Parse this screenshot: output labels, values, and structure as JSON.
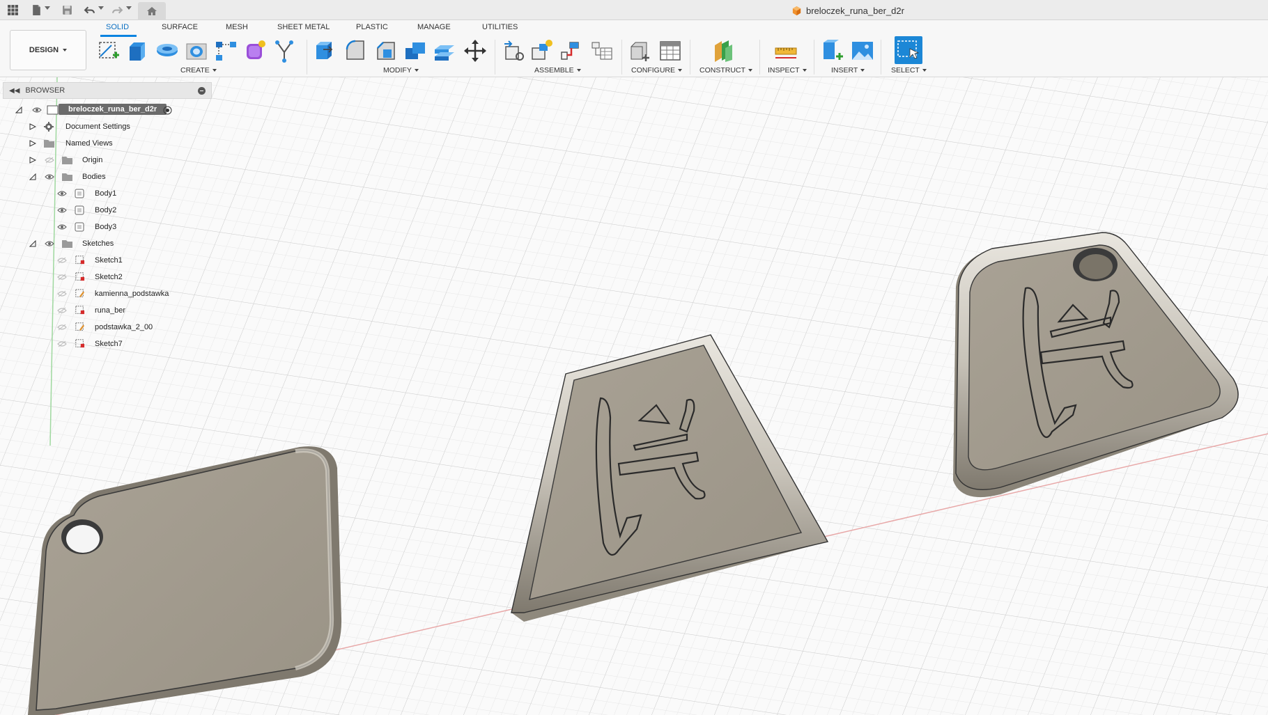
{
  "title_bar": {
    "document_title": "breloczek_runa_ber_d2r",
    "icons": [
      "grid-menu-icon",
      "file-icon",
      "save-icon",
      "undo-icon",
      "redo-icon",
      "home-icon",
      "document-cube-icon"
    ]
  },
  "toolbar": {
    "workspace_label": "DESIGN",
    "tabs": [
      {
        "label": "SOLID",
        "active": true
      },
      {
        "label": "SURFACE",
        "active": false
      },
      {
        "label": "MESH",
        "active": false
      },
      {
        "label": "SHEET METAL",
        "active": false
      },
      {
        "label": "PLASTIC",
        "active": false
      },
      {
        "label": "MANAGE",
        "active": false
      },
      {
        "label": "UTILITIES",
        "active": false
      }
    ],
    "groups": [
      {
        "label": "CREATE",
        "tools": [
          "create-sketch-icon",
          "extrude-icon",
          "revolve-icon",
          "hole-icon",
          "rectangular-pattern-icon",
          "create-form-icon",
          "derive-icon"
        ]
      },
      {
        "label": "MODIFY",
        "tools": [
          "press-pull-icon",
          "fillet-icon",
          "chamfer-icon",
          "combine-icon",
          "offset-face-icon",
          "move-icon"
        ]
      },
      {
        "label": "ASSEMBLE",
        "tools": [
          "new-component-icon",
          "joint-icon",
          "as-built-joint-icon",
          "joint-origin-icon"
        ]
      },
      {
        "label": "CONFIGURE",
        "tools": [
          "configure-icon",
          "configuration-table-icon"
        ]
      },
      {
        "label": "CONSTRUCT",
        "tools": [
          "offset-plane-icon"
        ]
      },
      {
        "label": "INSPECT",
        "tools": [
          "measure-icon"
        ]
      },
      {
        "label": "INSERT",
        "tools": [
          "insert-derive-icon",
          "insert-image-icon"
        ]
      },
      {
        "label": "SELECT",
        "tools": [
          "select-icon"
        ]
      }
    ],
    "accent_color": "#0a83e0"
  },
  "browser": {
    "title": "BROWSER",
    "root": "breloczek_runa_ber_d2r",
    "items": [
      {
        "label": "Document Settings",
        "icon": "gear-icon"
      },
      {
        "label": "Named Views",
        "icon": "folder-icon"
      },
      {
        "label": "Origin",
        "icon": "folder-icon"
      },
      {
        "label": "Bodies",
        "icon": "folder-icon"
      },
      {
        "label": "Body1",
        "icon": "body-icon"
      },
      {
        "label": "Body2",
        "icon": "body-icon"
      },
      {
        "label": "Body3",
        "icon": "body-icon"
      },
      {
        "label": "Sketches",
        "icon": "folder-icon"
      },
      {
        "label": "Sketch1",
        "icon": "sketch-icon"
      },
      {
        "label": "Sketch2",
        "icon": "sketch-icon"
      },
      {
        "label": "kamienna_podstawka",
        "icon": "sketch-icon"
      },
      {
        "label": "runa_ber",
        "icon": "sketch-icon"
      },
      {
        "label": "podstawka_2_00",
        "icon": "sketch-icon"
      },
      {
        "label": "Sketch7",
        "icon": "sketch-icon"
      }
    ]
  },
  "viewport": {
    "bodies": [
      "Body1",
      "Body2",
      "Body3"
    ],
    "body_color": "#a39c8f",
    "edge_color": "#3a3a3a"
  }
}
